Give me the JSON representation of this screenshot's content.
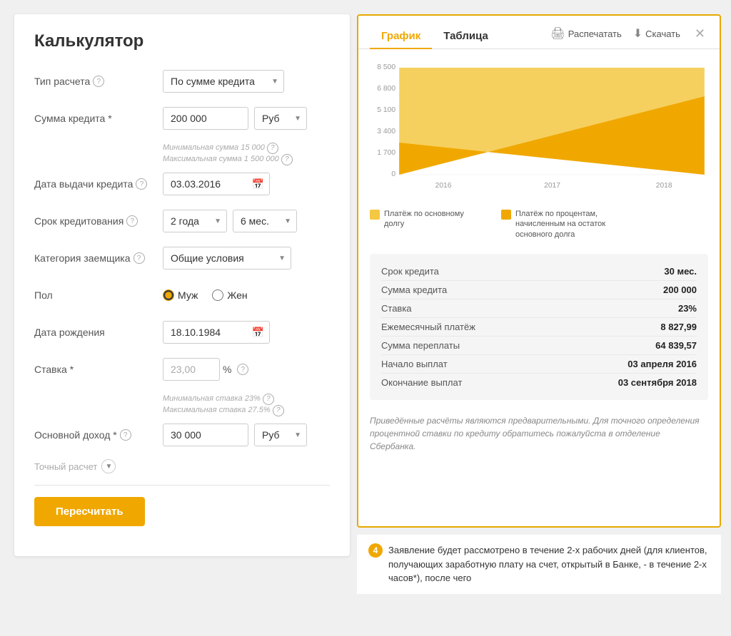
{
  "calculator": {
    "title": "Калькулятор",
    "fields": {
      "calc_type_label": "Тип расчета",
      "calc_type_value": "По сумме кредита",
      "credit_amount_label": "Сумма кредита *",
      "credit_amount_value": "200 000",
      "credit_amount_currency": "Руб",
      "credit_amount_hint1": "Минимальная сумма 15 000",
      "credit_amount_hint2": "Максимальная сумма 1 500 000",
      "issue_date_label": "Дата выдачи кредита",
      "issue_date_value": "03.03.2016",
      "term_label": "Срок кредитования",
      "term_years": "2 года",
      "term_months": "6 мес.",
      "borrower_category_label": "Категория заемщика",
      "borrower_category_value": "Общие условия",
      "gender_label": "Пол",
      "gender_male": "Муж",
      "gender_female": "Жен",
      "birth_date_label": "Дата рождения",
      "birth_date_value": "18.10.1984",
      "rate_label": "Ставка *",
      "rate_value": "23,00",
      "rate_unit": "%",
      "rate_hint1": "Минимальная ставка 23%",
      "rate_hint2": "Максимальная ставка 27.5%",
      "income_label": "Основной доход *",
      "income_value": "30 000",
      "income_currency": "Руб",
      "exact_calc_label": "Точный расчет",
      "recalc_btn": "Пересчитать"
    }
  },
  "results": {
    "tab_graph": "График",
    "tab_table": "Таблица",
    "print_label": "Распечатать",
    "download_label": "Скачать",
    "chart": {
      "y_labels": [
        "8 500",
        "6 800",
        "5 100",
        "3 400",
        "1 700",
        "0"
      ],
      "x_labels": [
        "2016",
        "2017",
        "2018"
      ],
      "legend_principal": "Платёж по основному долгу",
      "legend_interest": "Платёж по процентам, начисленным на остаток основного долга",
      "color_principal": "#f0c040",
      "color_interest": "#f0a800"
    },
    "summary": {
      "term_label": "Срок кредита",
      "term_value": "30 мес.",
      "amount_label": "Сумма кредита",
      "amount_value": "200 000",
      "rate_label": "Ставка",
      "rate_value": "23%",
      "monthly_label": "Ежемесячный платёж",
      "monthly_value": "8 827,99",
      "overpayment_label": "Сумма переплаты",
      "overpayment_value": "64 839,57",
      "start_label": "Начало выплат",
      "start_value": "03 апреля 2016",
      "end_label": "Окончание выплат",
      "end_value": "03 сентября 2018"
    },
    "disclaimer": "Приведённые расчёты являются предварительными. Для точного определения процентной ставки по кредиту обратитесь пожалуйста в отделение Сбербанка."
  },
  "step_content": {
    "step_num": "4",
    "text": "Заявление будет рассмотрено в течение 2-х рабочих дней (для клиентов, получающих заработную плату на счет, открытый в Банке, - в течение 2-х часов*), после чего"
  }
}
